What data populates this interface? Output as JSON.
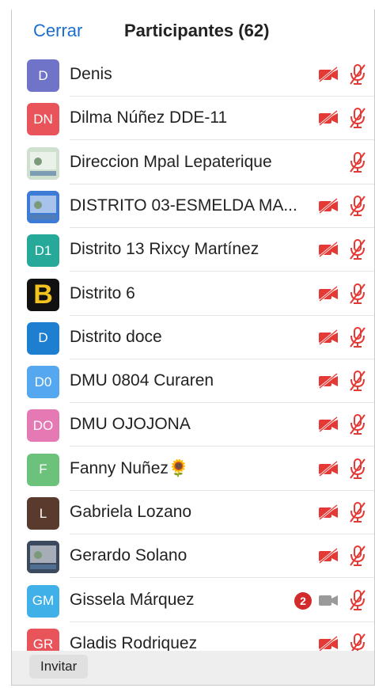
{
  "header": {
    "close_label": "Cerrar",
    "title": "Participantes (62)"
  },
  "colors": {
    "accent": "#1a6fd1",
    "muted_red": "#e53935",
    "badge_red": "#d32b2b"
  },
  "participants": [
    {
      "initials": "D",
      "name": "Denis",
      "avatar_color": "#6f74c9",
      "video": "off",
      "mic": "muted"
    },
    {
      "initials": "DN",
      "name": "Dilma Núñez DDE-11",
      "avatar_color": "#e8545a",
      "video": "off",
      "mic": "muted"
    },
    {
      "initials": "",
      "name": "Direccion Mpal Lepaterique",
      "avatar_color": "#cfe0cf",
      "avatar_icon": "photo-avatar",
      "video": "none",
      "mic": "muted"
    },
    {
      "initials": "",
      "name": "DISTRITO 03-ESMELDA MA...",
      "avatar_color": "#3d7bd6",
      "avatar_icon": "photo-avatar",
      "video": "off",
      "mic": "muted"
    },
    {
      "initials": "D1",
      "name": "Distrito 13 Rixcy Martínez",
      "avatar_color": "#27a99a",
      "video": "off",
      "mic": "muted"
    },
    {
      "initials": "B",
      "name": "Distrito 6",
      "avatar_color": "#f2c21f",
      "avatar_icon": "logo-avatar",
      "video": "off",
      "mic": "muted"
    },
    {
      "initials": "D",
      "name": "Distrito doce",
      "avatar_color": "#1e7fd0",
      "video": "off",
      "mic": "muted"
    },
    {
      "initials": "D0",
      "name": "DMU 0804 Curaren",
      "avatar_color": "#55a8f0",
      "video": "off",
      "mic": "muted"
    },
    {
      "initials": "DO",
      "name": "DMU OJOJONA",
      "avatar_color": "#e579b3",
      "video": "off",
      "mic": "muted"
    },
    {
      "initials": "F",
      "name": "Fanny Nuñez🌻",
      "avatar_color": "#6cc27b",
      "video": "off",
      "mic": "muted"
    },
    {
      "initials": "L",
      "name": "Gabriela Lozano",
      "avatar_color": "#5b3a2e",
      "video": "off",
      "mic": "muted"
    },
    {
      "initials": "",
      "name": "Gerardo Solano",
      "avatar_color": "#3b4a5e",
      "avatar_icon": "photo-avatar",
      "video": "off",
      "mic": "muted"
    },
    {
      "initials": "GM",
      "name": "Gissela Márquez",
      "avatar_color": "#3fb0e8",
      "video": "on",
      "mic": "muted",
      "badge": "2"
    },
    {
      "initials": "GR",
      "name": "Gladis Rodriquez",
      "avatar_color": "#e8545a",
      "video": "off",
      "mic": "muted"
    }
  ],
  "footer": {
    "invite_label": "Invitar"
  }
}
